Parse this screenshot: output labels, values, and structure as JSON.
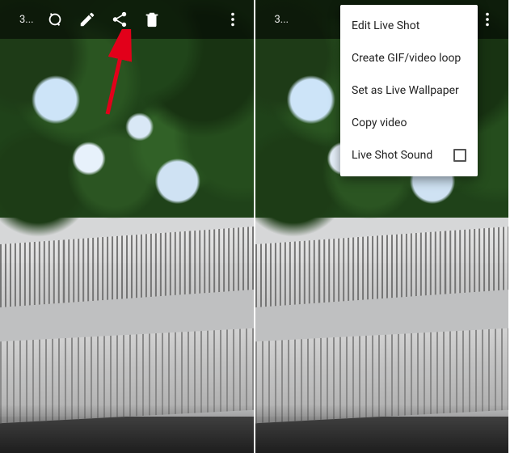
{
  "toolbar": {
    "title": "3..."
  },
  "menu": {
    "items": [
      {
        "label": "Edit Live Shot"
      },
      {
        "label": "Create GIF/video loop"
      },
      {
        "label": "Set as Live Wallpaper"
      },
      {
        "label": "Copy video"
      },
      {
        "label": "Live Shot Sound",
        "checkbox": true,
        "checked": false
      }
    ]
  }
}
